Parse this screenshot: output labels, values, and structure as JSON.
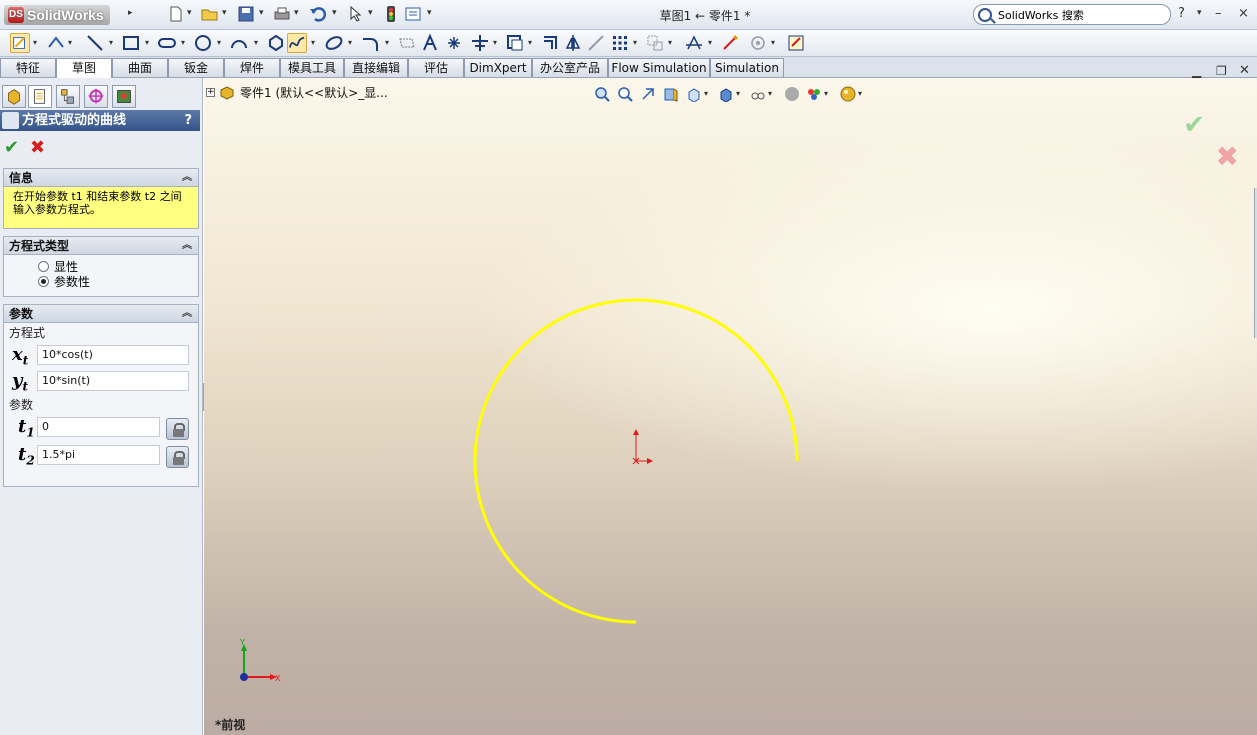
{
  "app": {
    "logo_text": "SolidWorks",
    "doc_title": "草图1 ← 零件1 *"
  },
  "search": {
    "placeholder": "SolidWorks 搜索"
  },
  "window": {
    "help": "?",
    "min": "–",
    "max": "×"
  },
  "tabs": [
    "特征",
    "草图",
    "曲面",
    "钣金",
    "焊件",
    "模具工具",
    "直接编辑",
    "评估",
    "DimXpert",
    "办公室产品",
    "Flow Simulation",
    "Simulation"
  ],
  "active_tab": "草图",
  "property_manager": {
    "title": "方程式驱动的曲线",
    "help": "?",
    "ok_symbol": "✔",
    "cancel_symbol": "✖",
    "info": {
      "title": "信息",
      "message": "在开始参数 t1 和结束参数 t2 之间输入参数方程式。"
    },
    "equation_type": {
      "title": "方程式类型",
      "options": [
        "显性",
        "参数性"
      ],
      "selected": "参数性"
    },
    "parameters": {
      "title": "参数",
      "equation_label": "方程式",
      "xt_var": "x",
      "xt_sub": "t",
      "xt": "10*cos(t)",
      "yt_var": "y",
      "yt_sub": "t",
      "yt": "10*sin(t)",
      "param_label": "参数",
      "t1_var": "t",
      "t1_sub": "1",
      "t1": "0",
      "t2_var": "t",
      "t2_sub": "2",
      "t2": "1.5*pi"
    }
  },
  "viewport": {
    "tree_item": "零件1  (默认<<默认>_显...",
    "view_name": "*前视",
    "accept_symbol": "✔",
    "reject_symbol": "✖",
    "axis_y": "Y",
    "axis_x": "X",
    "curve": {
      "type": "parametric",
      "x_eq": "10*cos(t)",
      "y_eq": "10*sin(t)",
      "t_start": 0,
      "t_end": 4.712,
      "color": "#ffff00"
    }
  },
  "colors": {
    "header": "#34548a",
    "info_bg": "#ffff80",
    "curve": "#ffff00",
    "origin": "#e01a1a"
  }
}
